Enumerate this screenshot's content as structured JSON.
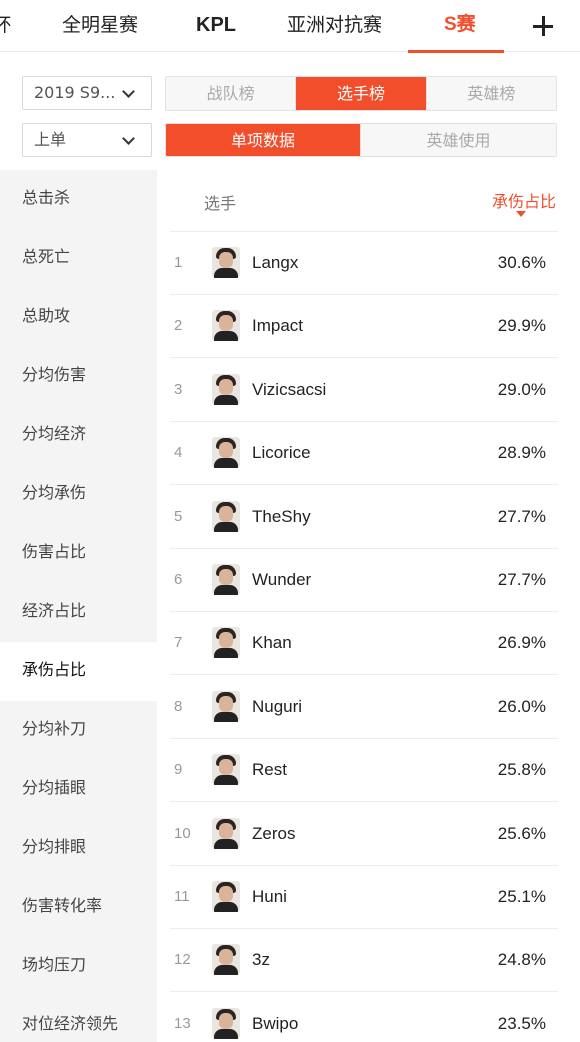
{
  "top_tabs": [
    "杯",
    "全明星赛",
    "KPL",
    "亚洲对抗赛",
    "S赛"
  ],
  "top_tabs_active": "S赛",
  "accent_color": "#f24e2b",
  "filters": {
    "season": "2019 S9...",
    "position": "上单"
  },
  "rank_tabs": [
    "战队榜",
    "选手榜",
    "英雄榜"
  ],
  "rank_tabs_active": "选手榜",
  "data_tabs": [
    "单项数据",
    "英雄使用"
  ],
  "data_tabs_active": "单项数据",
  "sidebar": {
    "items": [
      "总击杀",
      "总死亡",
      "总助攻",
      "分均伤害",
      "分均经济",
      "分均承伤",
      "伤害占比",
      "经济占比",
      "承伤占比",
      "分均补刀",
      "分均插眼",
      "分均排眼",
      "伤害转化率",
      "场均压刀",
      "对位经济领先"
    ],
    "active": "承伤占比"
  },
  "table": {
    "col_player": "选手",
    "col_stat": "承伤占比",
    "rows": [
      {
        "rank": "1",
        "name": "Langx",
        "value": "30.6%"
      },
      {
        "rank": "2",
        "name": "Impact",
        "value": "29.9%"
      },
      {
        "rank": "3",
        "name": "Vizicsacsi",
        "value": "29.0%"
      },
      {
        "rank": "4",
        "name": "Licorice",
        "value": "28.9%"
      },
      {
        "rank": "5",
        "name": "TheShy",
        "value": "27.7%"
      },
      {
        "rank": "6",
        "name": "Wunder",
        "value": "27.7%"
      },
      {
        "rank": "7",
        "name": "Khan",
        "value": "26.9%"
      },
      {
        "rank": "8",
        "name": "Nuguri",
        "value": "26.0%"
      },
      {
        "rank": "9",
        "name": "Rest",
        "value": "25.8%"
      },
      {
        "rank": "10",
        "name": "Zeros",
        "value": "25.6%"
      },
      {
        "rank": "11",
        "name": "Huni",
        "value": "25.1%"
      },
      {
        "rank": "12",
        "name": "3z",
        "value": "24.8%"
      },
      {
        "rank": "13",
        "name": "Bwipo",
        "value": "23.5%"
      }
    ]
  }
}
